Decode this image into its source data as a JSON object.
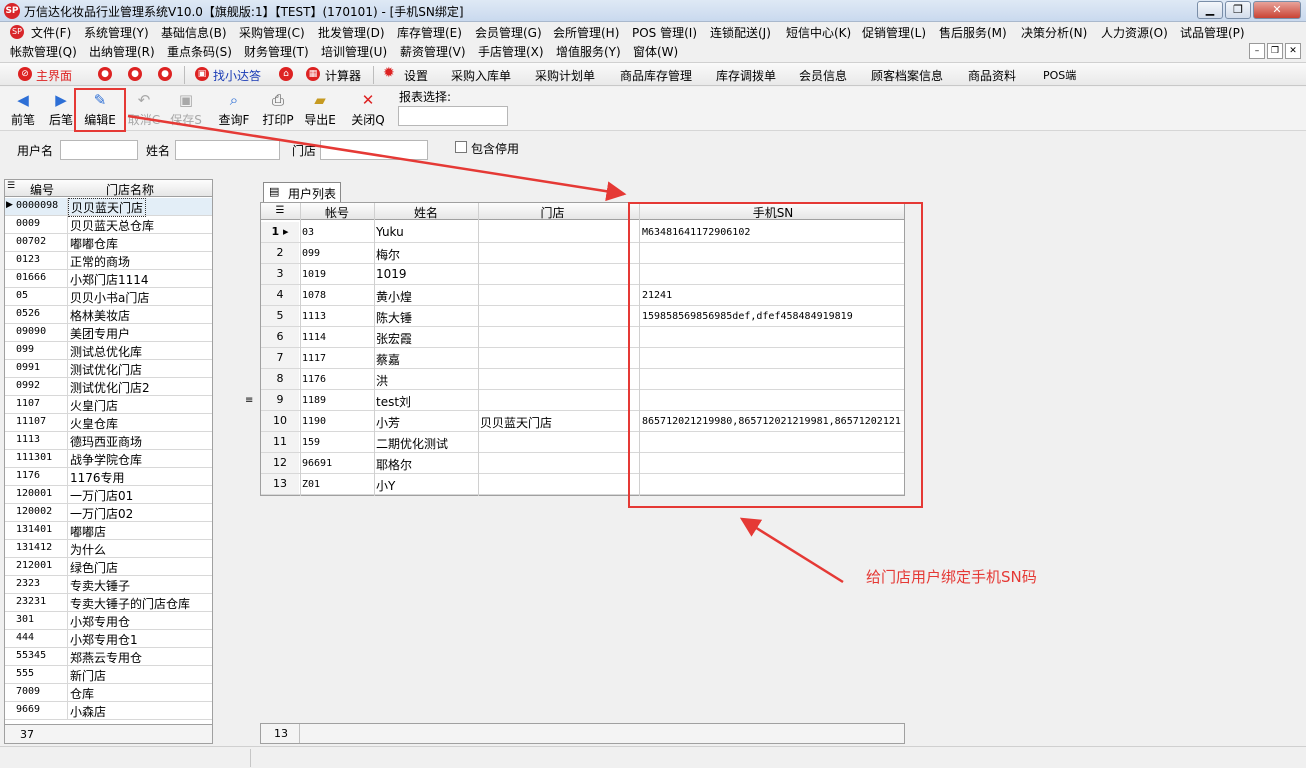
{
  "window": {
    "title": "万信达化妆品行业管理系统V10.0【旗舰版:1】【TEST】(170101) - [手机SN绑定]",
    "logo_text": "SP"
  },
  "menu_row1": [
    "文件(F)",
    "系统管理(Y)",
    "基础信息(B)",
    "采购管理(C)",
    "批发管理(D)",
    "库存管理(E)",
    "会员管理(G)",
    "会所管理(H)",
    "POS 管理(I)",
    "连锁配送(J)",
    "短信中心(K)",
    "促销管理(L)",
    "售后服务(M)",
    "决策分析(N)",
    "人力资源(O)",
    "试品管理(P)"
  ],
  "menu_row2": [
    "帐款管理(Q)",
    "出纳管理(R)",
    "重点条码(S)",
    "财务管理(T)",
    "培训管理(U)",
    "薪资管理(V)",
    "手店管理(X)",
    "增值服务(Y)",
    "窗体(W)"
  ],
  "quickbar": {
    "home": "主界面",
    "find": "找小达答",
    "calculator": "计算器",
    "settings": "设置",
    "links": [
      "采购入库单",
      "采购计划单",
      "商品库存管理",
      "库存调拨单",
      "会员信息",
      "顾客档案信息",
      "商品资料",
      "POS端"
    ]
  },
  "toolbar": {
    "prev": "前笔",
    "next": "后笔",
    "edit": "编辑E",
    "cancel": "取消C",
    "save": "保存S",
    "query": "查询F",
    "print": "打印P",
    "export": "导出E",
    "close": "关闭Q",
    "report_label": "报表选择:"
  },
  "filters": {
    "username_label": "用户名",
    "name_label": "姓名",
    "store_label": "门店",
    "include_disabled_label": "包含停用",
    "include_disabled": false
  },
  "store_list": {
    "headers": [
      "编号",
      "门店名称"
    ],
    "rows": [
      [
        "0000098",
        "贝贝蓝天门店"
      ],
      [
        "0009",
        "贝贝蓝天总仓库"
      ],
      [
        "00702",
        "嘟嘟仓库"
      ],
      [
        "0123",
        "正常的商场"
      ],
      [
        "01666",
        "小郑门店1114"
      ],
      [
        "05",
        "贝贝小书a门店"
      ],
      [
        "0526",
        "格林美妆店"
      ],
      [
        "09090",
        "美团专用户"
      ],
      [
        "099",
        "测试总优化库"
      ],
      [
        "0991",
        "测试优化门店"
      ],
      [
        "0992",
        "测试优化门店2"
      ],
      [
        "1107",
        "火皇门店"
      ],
      [
        "11107",
        "火皇仓库"
      ],
      [
        "1113",
        "德玛西亚商场"
      ],
      [
        "111301",
        "战争学院仓库"
      ],
      [
        "1176",
        "1176专用"
      ],
      [
        "120001",
        "一万门店01"
      ],
      [
        "120002",
        "一万门店02"
      ],
      [
        "131401",
        "嘟嘟店"
      ],
      [
        "131412",
        "为什么"
      ],
      [
        "212001",
        "绿色门店"
      ],
      [
        "2323",
        "专卖大锤子"
      ],
      [
        "23231",
        "专卖大锤子的门店仓库"
      ],
      [
        "301",
        "小郑专用仓"
      ],
      [
        "444",
        "小郑专用仓1"
      ],
      [
        "55345",
        "郑燕云专用仓"
      ],
      [
        "555",
        "新门店"
      ],
      [
        "7009",
        "仓库"
      ],
      [
        "9669",
        "小森店"
      ]
    ],
    "count": "37"
  },
  "tab_label": "用户列表",
  "user_list": {
    "headers": [
      "帐号",
      "姓名",
      "门店",
      "手机SN"
    ],
    "rows": [
      {
        "no": "1",
        "account": "03",
        "name": "Yuku",
        "store": "",
        "sn": "M63481641172906102"
      },
      {
        "no": "2",
        "account": "099",
        "name": "梅尔",
        "store": "",
        "sn": ""
      },
      {
        "no": "3",
        "account": "1019",
        "name": "1019",
        "store": "",
        "sn": ""
      },
      {
        "no": "4",
        "account": "1078",
        "name": "黄小煌",
        "store": "",
        "sn": "21241"
      },
      {
        "no": "5",
        "account": "1113",
        "name": "陈大锤",
        "store": "",
        "sn": "159858569856985def,dfef458484919819"
      },
      {
        "no": "6",
        "account": "1114",
        "name": "张宏霞",
        "store": "",
        "sn": ""
      },
      {
        "no": "7",
        "account": "1117",
        "name": "蔡嘉",
        "store": "",
        "sn": ""
      },
      {
        "no": "8",
        "account": "1176",
        "name": "洪",
        "store": "",
        "sn": ""
      },
      {
        "no": "9",
        "account": "1189",
        "name": "test刘",
        "store": "",
        "sn": ""
      },
      {
        "no": "10",
        "account": "1190",
        "name": "小芳",
        "store": "贝贝蓝天门店",
        "sn": "865712021219980,865712021219981,86571202121"
      },
      {
        "no": "11",
        "account": "159",
        "name": "二期优化测试",
        "store": "",
        "sn": ""
      },
      {
        "no": "12",
        "account": "96691",
        "name": "耶格尔",
        "store": "",
        "sn": ""
      },
      {
        "no": "13",
        "account": "Z01",
        "name": "小Y",
        "store": "",
        "sn": ""
      }
    ],
    "count": "13"
  },
  "annotation": "给门店用户绑定手机SN码",
  "colors": {
    "highlight": "#e53935",
    "accent": "#d22"
  }
}
